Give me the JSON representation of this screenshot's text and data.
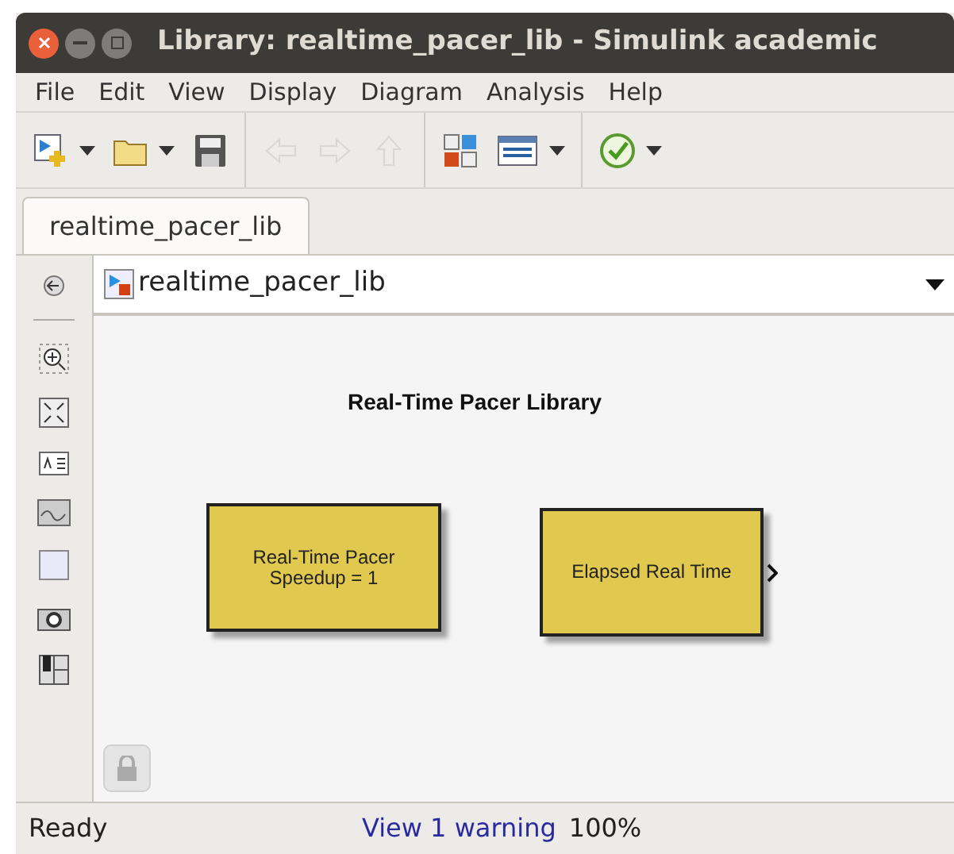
{
  "window": {
    "title": "Library: realtime_pacer_lib - Simulink academic"
  },
  "menu": [
    "File",
    "Edit",
    "View",
    "Display",
    "Diagram",
    "Analysis",
    "Help"
  ],
  "toolbar": [
    [
      {
        "dropdown": true,
        "disabled": false
      },
      {
        "dropdown": true,
        "disabled": false
      },
      {
        "dropdown": false,
        "disabled": false
      }
    ],
    [
      {
        "dropdown": false,
        "disabled": true
      },
      {
        "dropdown": false,
        "disabled": true
      },
      {
        "dropdown": false,
        "disabled": true
      }
    ],
    [
      {
        "dropdown": false,
        "disabled": false
      },
      {
        "dropdown": true,
        "disabled": false
      }
    ],
    [
      {
        "dropdown": true,
        "disabled": false
      }
    ]
  ],
  "tabs": [
    {
      "label": "realtime_pacer_lib",
      "selected": true
    }
  ],
  "address": {
    "text": "realtime_pacer_lib"
  },
  "canvas": {
    "title": "Real-Time Pacer Library",
    "blocks": [
      {
        "lines": [
          "Real-Time Pacer",
          "Speedup = 1"
        ],
        "output_port": false
      },
      {
        "lines": [
          "Elapsed Real Time"
        ],
        "output_port": true
      }
    ]
  },
  "status_bar": {
    "state": "Ready",
    "warning": "View 1 warning",
    "zoom": "100%"
  }
}
